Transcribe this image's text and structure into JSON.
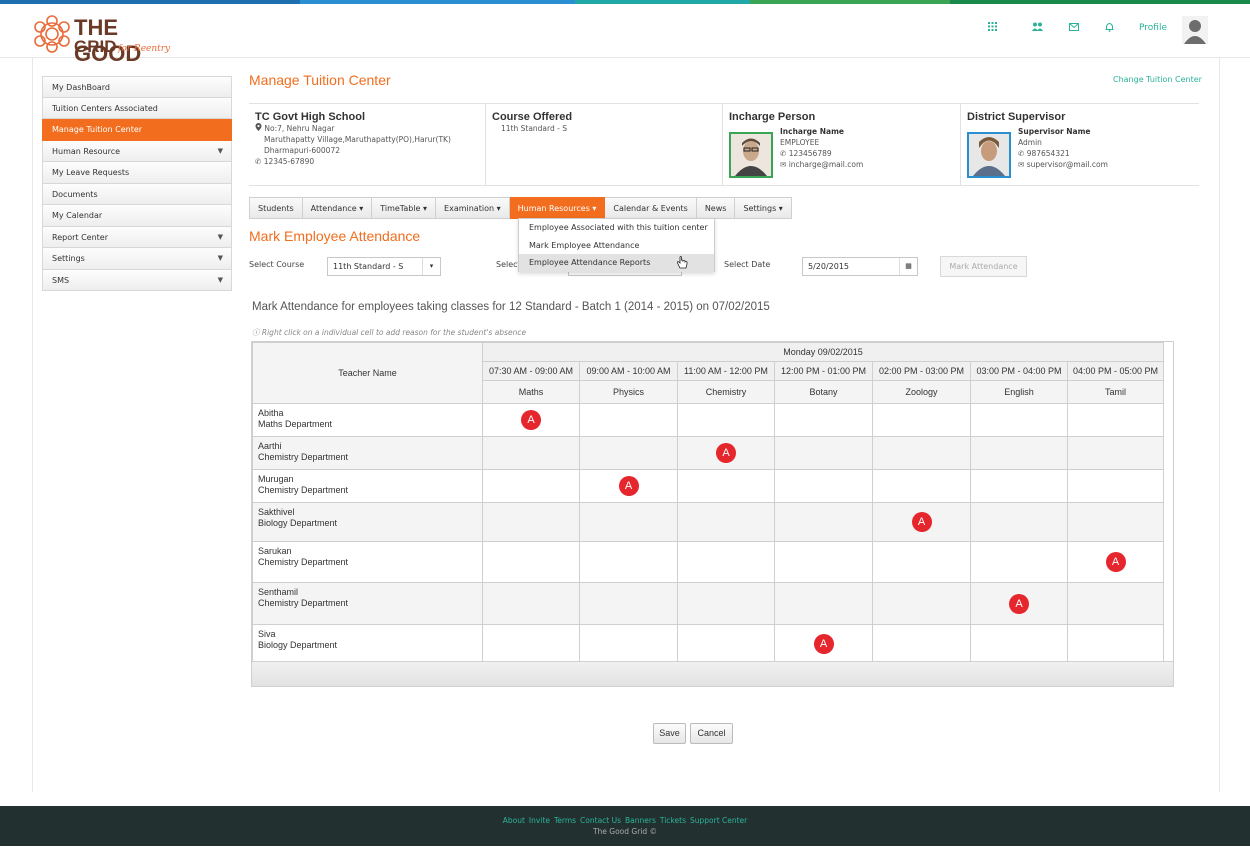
{
  "brand": {
    "line1": "THE GOOD",
    "line2": "GRID",
    "tagline": "for Reentry",
    "colors": {
      "accent": "#f26d1e",
      "teal": "#2bb39a",
      "absent": "#e5262d"
    }
  },
  "header": {
    "icons": [
      "apps-grid-icon",
      "users-icon",
      "mail-icon",
      "bell-icon"
    ],
    "profile_label": "Profile"
  },
  "sidebar": {
    "items": [
      {
        "label": "My DashBoard",
        "caret": false
      },
      {
        "label": "Tuition Centers Associated",
        "caret": false
      },
      {
        "label": "Manage Tuition Center",
        "caret": false,
        "active": true
      },
      {
        "label": "Human Resource",
        "caret": true
      },
      {
        "label": "My Leave Requests",
        "caret": false
      },
      {
        "label": "Documents",
        "caret": false
      },
      {
        "label": "My Calendar",
        "caret": false
      },
      {
        "label": "Report Center",
        "caret": true
      },
      {
        "label": "Settings",
        "caret": true
      },
      {
        "label": "SMS",
        "caret": true
      }
    ]
  },
  "page": {
    "title": "Manage Tuition Center",
    "change_link": "Change Tuition Center"
  },
  "center": {
    "name": "TC Govt High School",
    "address1": "No:7, Nehru Nagar",
    "address2": "Maruthapatty Village,Maruthapatty(PO),Harur(TK)",
    "address3": "Dharmapuri-600072",
    "phone": "12345-67890"
  },
  "course": {
    "heading": "Course Offered",
    "value": "11th Standard - S"
  },
  "incharge": {
    "heading": "Incharge Person",
    "name": "Incharge Name",
    "role": "EMPLOYEE",
    "phone": "123456789",
    "email": "incharge@mail.com"
  },
  "supervisor": {
    "heading": "District Supervisor",
    "name": "Supervisor Name",
    "role": "Admin",
    "phone": "987654321",
    "email": "supervisor@mail.com"
  },
  "tabs": [
    {
      "label": "Students",
      "caret": false
    },
    {
      "label": "Attendance",
      "caret": true
    },
    {
      "label": "TimeTable",
      "caret": true
    },
    {
      "label": "Examination",
      "caret": true
    },
    {
      "label": "Human Resources",
      "caret": true,
      "active": true
    },
    {
      "label": "Calendar & Events",
      "caret": false
    },
    {
      "label": "News",
      "caret": false
    },
    {
      "label": "Settings",
      "caret": true
    }
  ],
  "dropdown": {
    "items": [
      "Employee Associated with this tuition center",
      "Mark Employee Attendance",
      "Employee Attendance Reports"
    ],
    "hover_index": 2
  },
  "form": {
    "section_title": "Mark Employee Attendance",
    "course_label": "Select Course",
    "course_value": "11th Standard - S",
    "batch_label": "Select",
    "date_label": "Select Date",
    "date_value": "5/20/2015",
    "mark_button": "Mark Attendance"
  },
  "grid": {
    "subtitle": "Mark Attendance for employees taking classes for 12 Standard - Batch 1 (2014 - 2015) on 07/02/2015",
    "hint": "Right click on a individual cell to add reason for the student's absence",
    "name_header": "Teacher Name",
    "day_header": "Monday 09/02/2015",
    "absent_mark": "A",
    "slots": [
      {
        "time": "07:30 AM - 09:00 AM",
        "subject": "Maths"
      },
      {
        "time": "09:00 AM - 10:00 AM",
        "subject": "Physics"
      },
      {
        "time": "11:00 AM - 12:00 PM",
        "subject": "Chemistry"
      },
      {
        "time": "12:00 PM - 01:00 PM",
        "subject": "Botany"
      },
      {
        "time": "02:00 PM - 03:00 PM",
        "subject": "Zoology"
      },
      {
        "time": "03:00 PM - 04:00 PM",
        "subject": "English"
      },
      {
        "time": "04:00 PM - 05:00 PM",
        "subject": "Tamil"
      }
    ],
    "rows": [
      {
        "name": "Abitha",
        "dept": "Maths Department",
        "absent_slot": 0
      },
      {
        "name": "Aarthi",
        "dept": "Chemistry Department",
        "absent_slot": 2
      },
      {
        "name": "Murugan",
        "dept": "Chemistry Department",
        "absent_slot": 1
      },
      {
        "name": "Sakthivel",
        "dept": "Biology Department",
        "absent_slot": 4
      },
      {
        "name": "Sarukan",
        "dept": "Chemistry Department",
        "absent_slot": 6
      },
      {
        "name": "Senthamil",
        "dept": "Chemistry Department",
        "absent_slot": 5
      },
      {
        "name": "Siva",
        "dept": "Biology Department",
        "absent_slot": 3
      }
    ]
  },
  "actions": {
    "save": "Save",
    "cancel": "Cancel"
  },
  "footer": {
    "links": [
      "About",
      "Invite",
      "Terms",
      "Contact Us",
      "Banners",
      "Tickets",
      "Support Center"
    ],
    "copyright": "The Good Grid ©"
  }
}
